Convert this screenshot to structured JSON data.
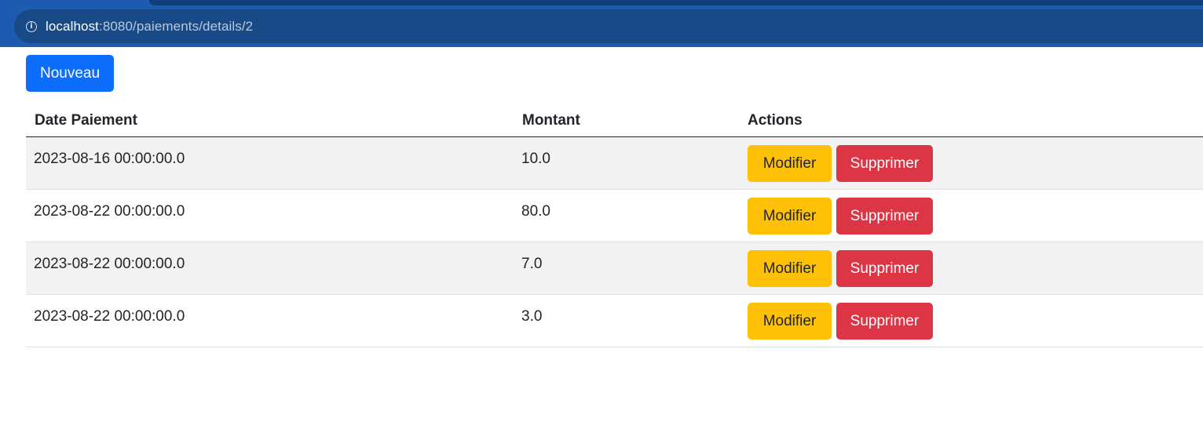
{
  "browser": {
    "url_host": "localhost",
    "url_rest": ":8080/paiements/details/2",
    "info_icon": "info-icon"
  },
  "toolbar": {
    "new_label": "Nouveau"
  },
  "table": {
    "headers": [
      "Date Paiement",
      "Montant",
      "Actions"
    ],
    "rows": [
      {
        "date": "2023-08-16 00:00:00.0",
        "amount": "10.0",
        "edit": "Modifier",
        "delete": "Supprimer"
      },
      {
        "date": "2023-08-22 00:00:00.0",
        "amount": "80.0",
        "edit": "Modifier",
        "delete": "Supprimer"
      },
      {
        "date": "2023-08-22 00:00:00.0",
        "amount": "7.0",
        "edit": "Modifier",
        "delete": "Supprimer"
      },
      {
        "date": "2023-08-22 00:00:00.0",
        "amount": "3.0",
        "edit": "Modifier",
        "delete": "Supprimer"
      }
    ]
  },
  "colors": {
    "primary": "#0d6efd",
    "warning": "#ffc107",
    "danger": "#dc3545",
    "browser_bar": "#1d5bb0"
  }
}
